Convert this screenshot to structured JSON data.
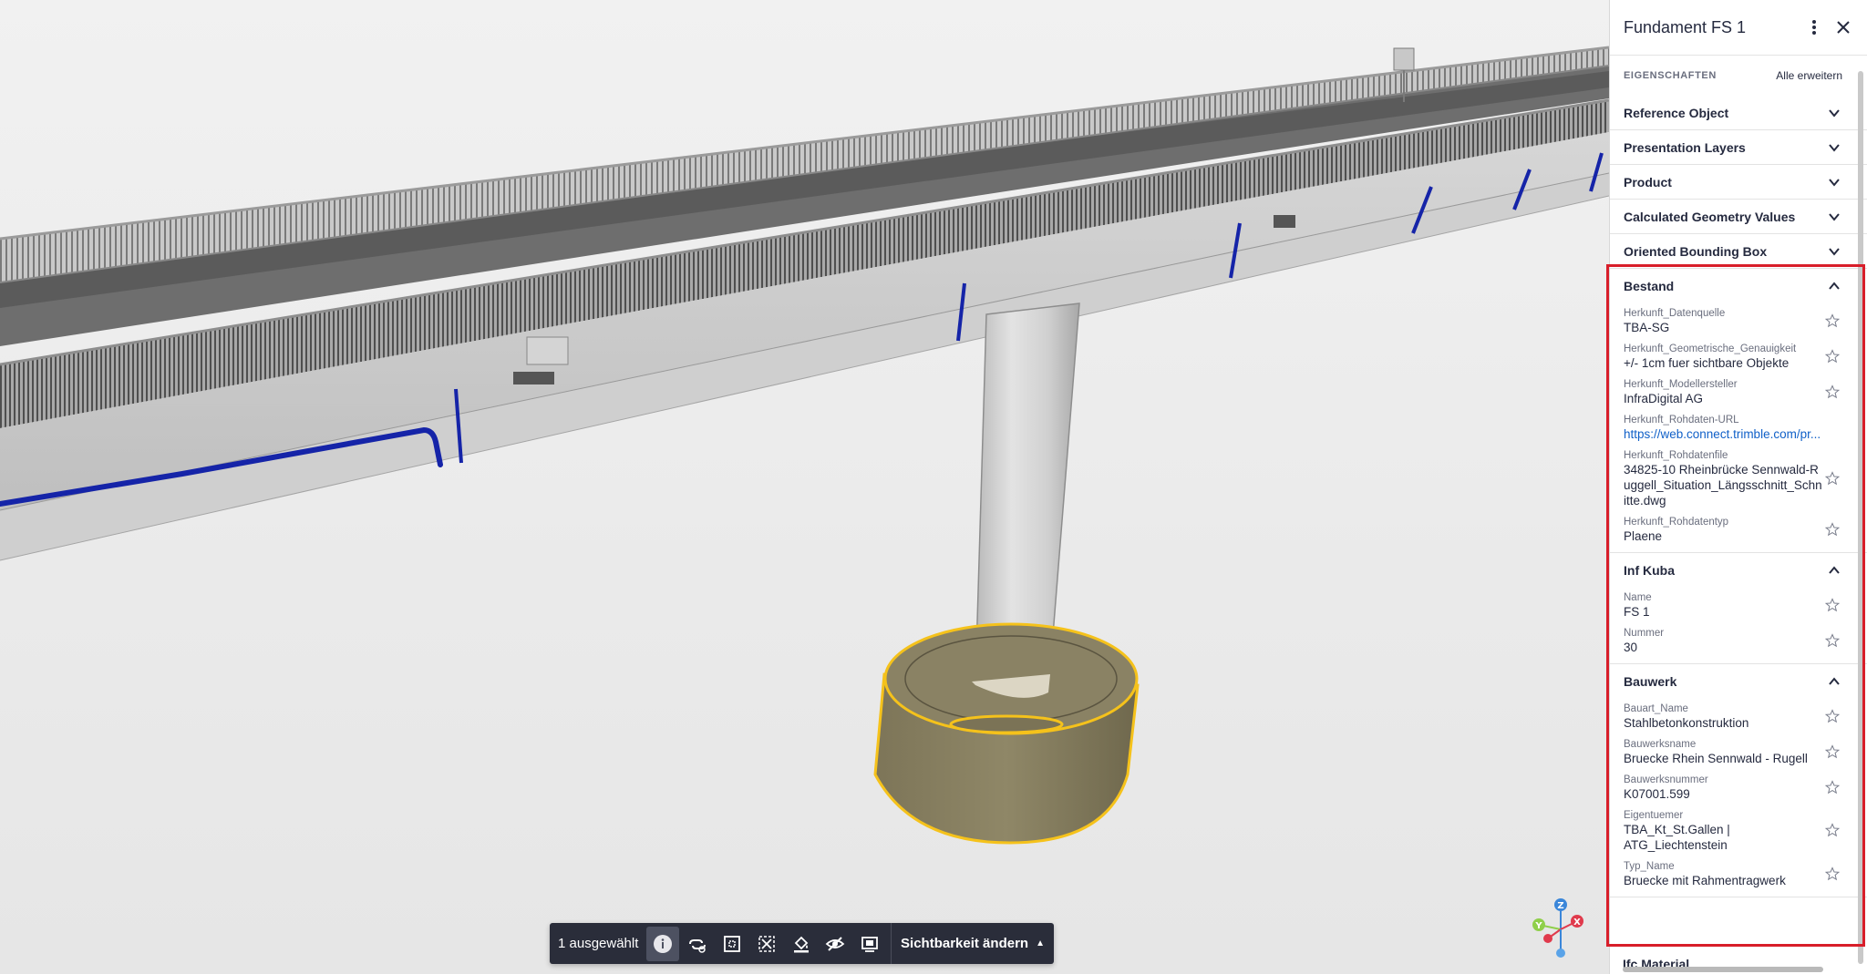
{
  "viewport": {
    "selection_label": "1 ausgewählt",
    "visibility_label": "Sichtbarkeit ändern",
    "tools": [
      "info-icon",
      "link-object-icon",
      "fit-selection-icon",
      "isolate-icon",
      "paint-icon",
      "hide-icon",
      "section-box-icon"
    ],
    "axes": {
      "z": "Z",
      "y": "Y",
      "x": "X"
    }
  },
  "panel": {
    "title": "Fundament FS 1",
    "properties_label": "EIGENSCHAFTEN",
    "expand_all_label": "Alle erweitern",
    "collapsed_sections": [
      "Reference Object",
      "Presentation Layers",
      "Product",
      "Calculated Geometry Values",
      "Oriented Bounding Box"
    ],
    "bestand": {
      "title": "Bestand",
      "props": [
        {
          "key": "Herkunft_Datenquelle",
          "value": "TBA-SG"
        },
        {
          "key": "Herkunft_Geometrische_Genauigkeit",
          "value": "+/- 1cm fuer sichtbare Objekte"
        },
        {
          "key": "Herkunft_Modellersteller",
          "value": "InfraDigital AG"
        },
        {
          "key": "Herkunft_Rohdaten-URL",
          "value": "https://web.connect.trimble.com/pr..."
        },
        {
          "key": "Herkunft_Rohdatenfile",
          "value": "34825-10 Rheinbrücke Sennwald-Ruggell_Situation_Längsschnitt_Schnitte.dwg"
        },
        {
          "key": "Herkunft_Rohdatentyp",
          "value": "Plaene"
        }
      ]
    },
    "inf_kuba": {
      "title": "Inf Kuba",
      "props": [
        {
          "key": "Name",
          "value": "FS 1"
        },
        {
          "key": "Nummer",
          "value": "30"
        }
      ]
    },
    "bauwerk": {
      "title": "Bauwerk",
      "props": [
        {
          "key": "Bauart_Name",
          "value": "Stahlbetonkonstruktion"
        },
        {
          "key": "Bauwerksname",
          "value": "Bruecke Rhein Sennwald - Rugell"
        },
        {
          "key": "Bauwerksnummer",
          "value": "K07001.599"
        },
        {
          "key": "Eigentuemer",
          "value": "TBA_Kt_St.Gallen | ATG_Liechtenstein"
        },
        {
          "key": "Typ_Name",
          "value": "Bruecke mit Rahmentragwerk"
        }
      ]
    },
    "next_section_partial": "Ifc Material"
  },
  "colors": {
    "highlight": "#d81e2a",
    "selection_outline": "#f5c21b",
    "pipe": "#1524a8",
    "link": "#1060c8",
    "toolbar_bg": "#2a2d3a"
  }
}
